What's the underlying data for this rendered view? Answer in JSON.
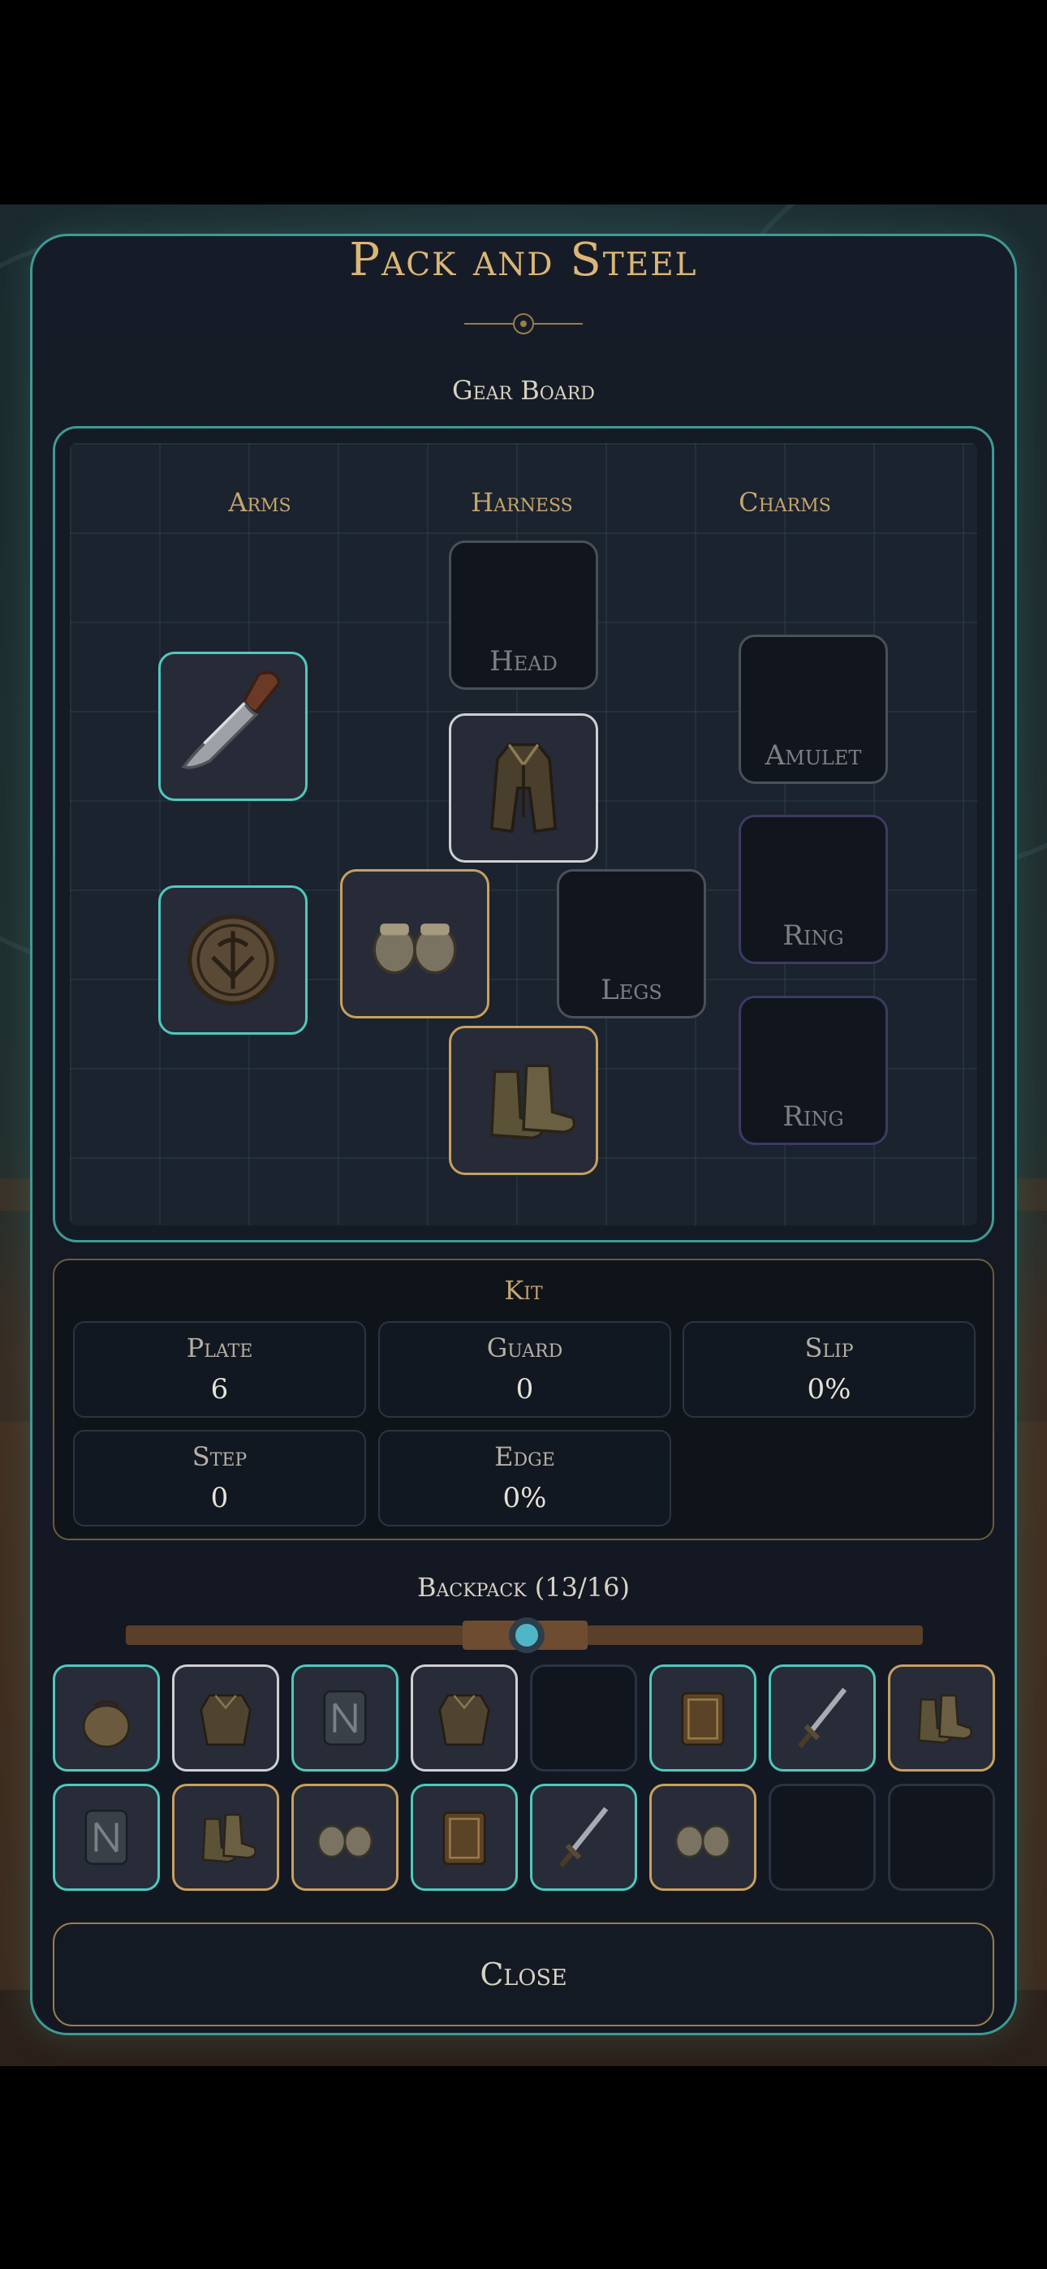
{
  "title": "Pack and Steel",
  "gear_board": {
    "label": "Gear Board",
    "columns": [
      "Arms",
      "Harness",
      "Charms"
    ],
    "empty_slots": {
      "head": "Head",
      "legs": "Legs",
      "amulet": "Amulet",
      "ring1": "Ring",
      "ring2": "Ring"
    },
    "equipped": {
      "weapon": "knife-icon",
      "offhand": "shield-icon",
      "chest": "coat-icon",
      "hands": "gauntlets-icon",
      "feet": "boots-icon"
    }
  },
  "kit": {
    "title": "Kit",
    "stats": [
      {
        "label": "Plate",
        "value": "6"
      },
      {
        "label": "Guard",
        "value": "0"
      },
      {
        "label": "Slip",
        "value": "0%"
      },
      {
        "label": "Step",
        "value": "0"
      },
      {
        "label": "Edge",
        "value": "0%"
      }
    ]
  },
  "backpack": {
    "label": "Backpack (13/16)",
    "used": 13,
    "capacity": 16,
    "slots": [
      {
        "icon": "pouch-icon",
        "rarity": "teal"
      },
      {
        "icon": "armor-icon",
        "rarity": "white"
      },
      {
        "icon": "tome-icon",
        "rarity": "teal"
      },
      {
        "icon": "armor-icon",
        "rarity": "white"
      },
      {
        "icon": "",
        "rarity": "empty"
      },
      {
        "icon": "book-icon",
        "rarity": "teal"
      },
      {
        "icon": "sword-icon",
        "rarity": "teal"
      },
      {
        "icon": "boots-icon",
        "rarity": "gold"
      },
      {
        "icon": "tome-icon",
        "rarity": "teal"
      },
      {
        "icon": "boots-icon",
        "rarity": "gold"
      },
      {
        "icon": "gauntlets-icon",
        "rarity": "gold"
      },
      {
        "icon": "book-icon",
        "rarity": "teal"
      },
      {
        "icon": "sword-icon",
        "rarity": "teal"
      },
      {
        "icon": "gauntlets-icon",
        "rarity": "gold"
      },
      {
        "icon": "",
        "rarity": "empty"
      },
      {
        "icon": "",
        "rarity": "empty"
      }
    ]
  },
  "close_label": "Close",
  "colors": {
    "accent_teal": "#4ec9be",
    "accent_gold": "#c8a05e",
    "title_gold": "#dcb676"
  }
}
